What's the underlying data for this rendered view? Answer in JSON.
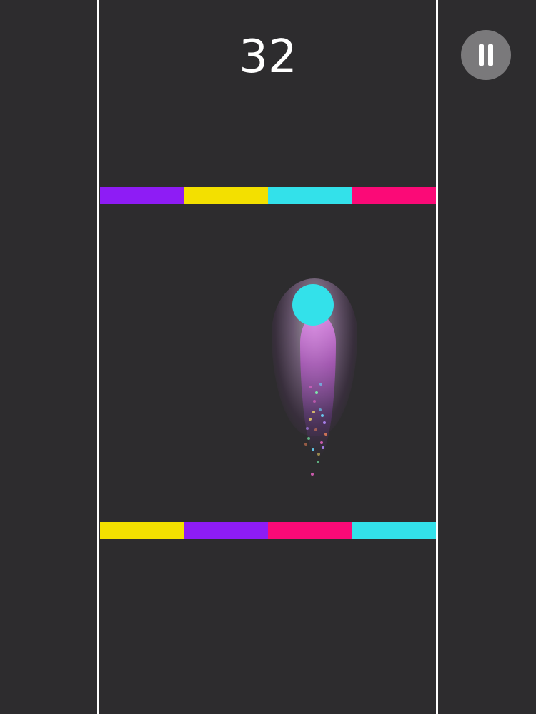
{
  "hud": {
    "score": "32",
    "pause_icon": "pause-icon"
  },
  "colors": {
    "background": "#2d2c2e",
    "purple": "#8e1cf5",
    "yellow": "#f3e000",
    "cyan": "#33e1ea",
    "pink": "#fb0a77",
    "lane_line": "#ffffff"
  },
  "top_bar": [
    "purple",
    "yellow",
    "cyan",
    "pink"
  ],
  "bottom_bar": [
    "yellow",
    "purple",
    "pink",
    "cyan"
  ],
  "ball": {
    "color": "cyan"
  }
}
